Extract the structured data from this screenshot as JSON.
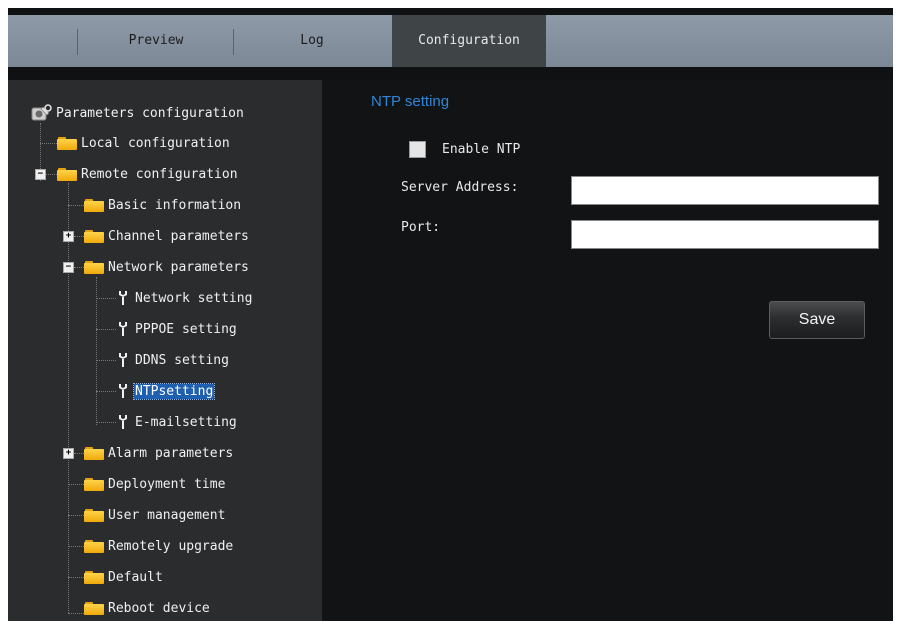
{
  "tabs": [
    {
      "label": "Preview"
    },
    {
      "label": "Log"
    },
    {
      "label": "Configuration",
      "active": true
    }
  ],
  "tree": {
    "root": "Parameters configuration",
    "items": {
      "local": "Local configuration",
      "remote": "Remote configuration",
      "basic": "Basic information",
      "channel": "Channel parameters",
      "network": "Network parameters",
      "network_setting": "Network setting",
      "pppoe": "PPPOE setting",
      "ddns": "DDNS setting",
      "ntp": "NTPsetting",
      "email": "E-mailsetting",
      "alarm": "Alarm parameters",
      "deployment": "Deployment time",
      "user": "User management",
      "upgrade": "Remotely upgrade",
      "default": "Default",
      "reboot": "Reboot device"
    },
    "selected": "NTPsetting"
  },
  "ntp": {
    "title": "NTP setting",
    "enable_label": "Enable NTP",
    "enable_checked": false,
    "server_label": "Server Address:",
    "server_value": "",
    "port_label": "Port:",
    "port_value": "",
    "save_label": "Save"
  },
  "colors": {
    "accent_title": "#2f86d6",
    "selection": "#1f5fb0",
    "folder": "#f0a90c",
    "active_tab": "#3f4447"
  },
  "icons": [
    "folder-icon",
    "wrench-icon",
    "expand-icon",
    "collapse-icon",
    "settings-root-icon"
  ]
}
